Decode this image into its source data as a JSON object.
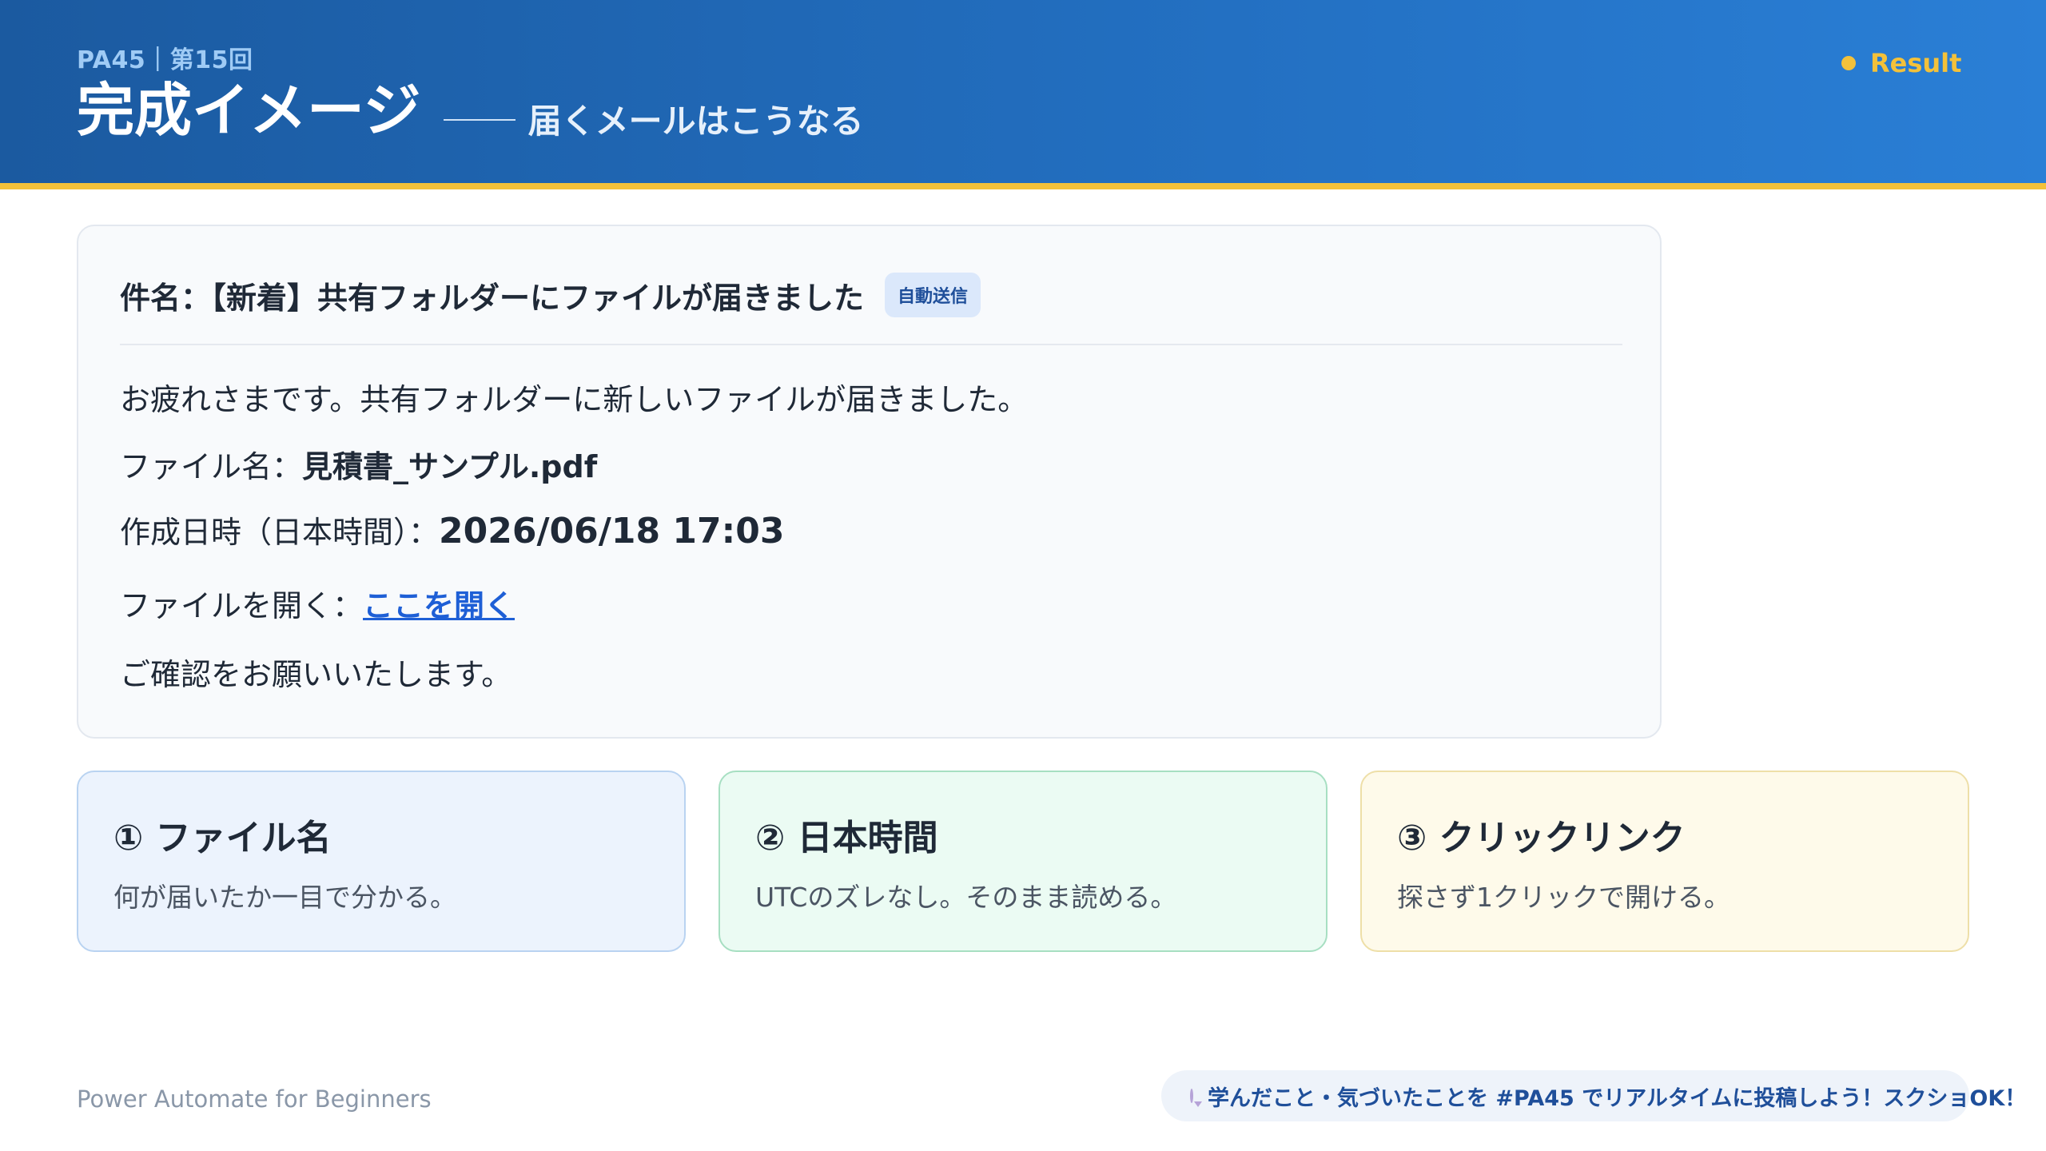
{
  "header": {
    "session": "PA45｜第15回",
    "title": "完成イメージ",
    "subtitle": "届くメールはこうなる",
    "badge": "Result"
  },
  "mail": {
    "subject": "件名：【新着】共有フォルダーにファイルが届きました",
    "auto_badge": "自動送信",
    "greeting": "お疲れさまです。共有フォルダーに新しいファイルが届きました。",
    "file_label": "ファイル名：",
    "file_value": "見積書_サンプル.pdf",
    "time_label": "作成日時（日本時間）：",
    "time_value": "2026/06/18 17:03",
    "open_label": "ファイルを開く：",
    "open_link": "ここを開く",
    "closing": "ご確認をお願いいたします。"
  },
  "points": [
    {
      "title": "① ファイル名",
      "desc": "何が届いたか一目で分かる。",
      "bg": "#ecf3fd",
      "border": "#b9d3f1"
    },
    {
      "title": "② 日本時間",
      "desc": "UTCのズレなし。そのまま読める。",
      "bg": "#ebfbf3",
      "border": "#a7dfc2"
    },
    {
      "title": "③ クリックリンク",
      "desc": "探さず1クリックで開ける。",
      "bg": "#fefaea",
      "border": "#eedfa8"
    }
  ],
  "footer": {
    "brand": "Power Automate for Beginners",
    "pill": "学んだこと・気づいたことを #PA45 でリアルタイムに投稿しよう！スクショOK！",
    "pill_icon": "speech-bubble-icon"
  },
  "colors": {
    "accent": "#f3c13a",
    "header_start": "#1b5aa0",
    "header_end": "#2a7fd6",
    "link": "#1e5fd6"
  }
}
